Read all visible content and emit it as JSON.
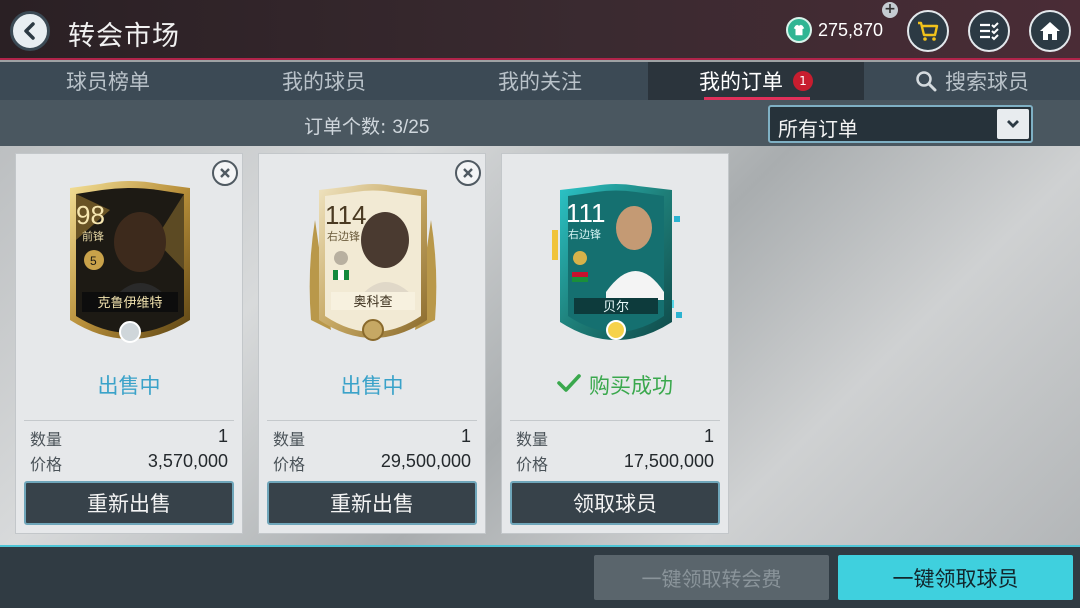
{
  "header": {
    "title": "转会市场",
    "coins": "275,870",
    "icons": [
      "back-arrow-icon",
      "coin-icon",
      "plus-icon",
      "cart-icon",
      "menu-list-icon",
      "home-icon"
    ]
  },
  "tabs": [
    {
      "label": "球员榜单"
    },
    {
      "label": "我的球员"
    },
    {
      "label": "我的关注"
    },
    {
      "label": "我的订单",
      "badge": "1"
    },
    {
      "label": "搜索球员"
    }
  ],
  "orders": {
    "count_label": "订单个数:",
    "count_value": "3/25",
    "filter_selected": "所有订单"
  },
  "cards": [
    {
      "rating": "98",
      "position": "前锋",
      "name": "克鲁伊维特",
      "level": "5",
      "status": "出售中",
      "qty_label": "数量",
      "qty": "1",
      "price_label": "价格",
      "price": "3,570,000",
      "action": "重新出售"
    },
    {
      "rating": "114",
      "position": "右边锋",
      "name": "奥科查",
      "status": "出售中",
      "qty_label": "数量",
      "qty": "1",
      "price_label": "价格",
      "price": "29,500,000",
      "action": "重新出售"
    },
    {
      "rating": "111",
      "position": "右边锋",
      "name": "贝尔",
      "status": "购买成功",
      "qty_label": "数量",
      "qty": "1",
      "price_label": "价格",
      "price": "17,500,000",
      "action": "领取球员"
    }
  ],
  "bottom": {
    "claim_fees": "一键领取转会费",
    "claim_players": "一键领取球员"
  },
  "colors": {
    "accent": "#3fd0de",
    "status_selling": "#3aa2c9",
    "status_success": "#3aa84d",
    "tab_underline": "#e0305a",
    "badge": "#c81d2f"
  }
}
